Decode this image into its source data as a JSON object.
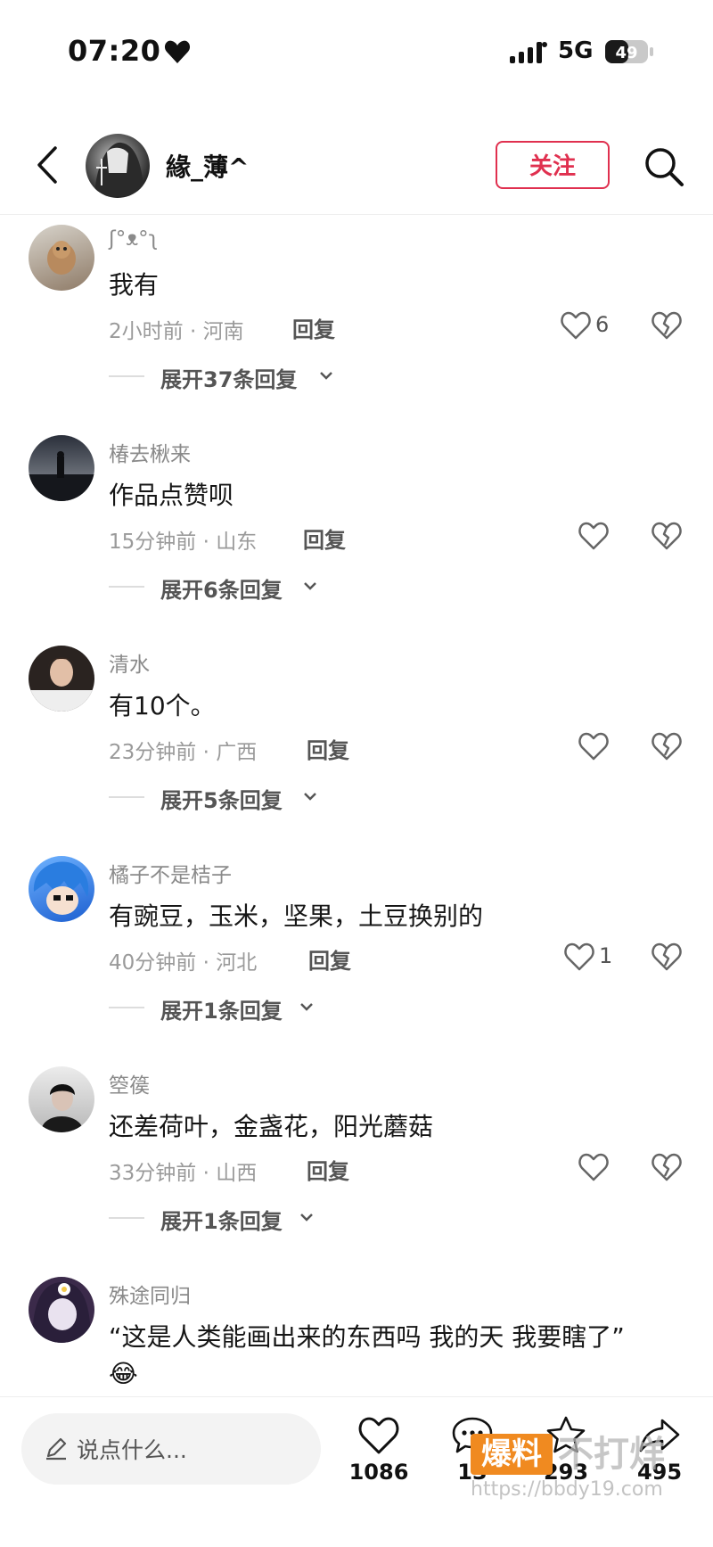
{
  "status_bar": {
    "time": "07:20",
    "network": "5G",
    "battery": "49"
  },
  "header": {
    "username": "緣_薄^",
    "follow_label": "关注"
  },
  "comments": [
    {
      "name": "ʃ°ᴥ°ʅ",
      "text": "我有",
      "meta": "2小时前 · 河南",
      "reply": "回复",
      "likes": "6",
      "expand": "展开37条回复"
    },
    {
      "name": "椿去楸来",
      "text": "作品点赞呗",
      "meta": "15分钟前 · 山东",
      "reply": "回复",
      "likes": "",
      "expand": "展开6条回复"
    },
    {
      "name": "清水",
      "text": "有10个。",
      "meta": "23分钟前 · 广西",
      "reply": "回复",
      "likes": "",
      "expand": "展开5条回复"
    },
    {
      "name": "橘子不是桔子",
      "text": "有豌豆，玉米，坚果，土豆换别的",
      "meta": "40分钟前 · 河北",
      "reply": "回复",
      "likes": "1",
      "expand": "展开1条回复"
    },
    {
      "name": "箜篌",
      "text": "还差荷叶，金盏花，阳光蘑菇",
      "meta": "33分钟前 · 山西",
      "reply": "回复",
      "likes": "",
      "expand": "展开1条回复"
    },
    {
      "name": "殊途同归",
      "text": "“这是人类能画出来的东西吗 我的天 我要瞎了”",
      "emoji": "😂"
    }
  ],
  "bottom_bar": {
    "input_placeholder": "说点什么...",
    "like_count": "1086",
    "comment_count": "13",
    "favorite_count": "293",
    "share_count": "495"
  },
  "watermark": {
    "badge": "爆料",
    "text": "不打烊",
    "url": "https://bbdy19.com"
  },
  "colors": {
    "accent": "#e0304f",
    "muted_text": "#9a9a9a",
    "watermark_orange": "#f08a20"
  }
}
